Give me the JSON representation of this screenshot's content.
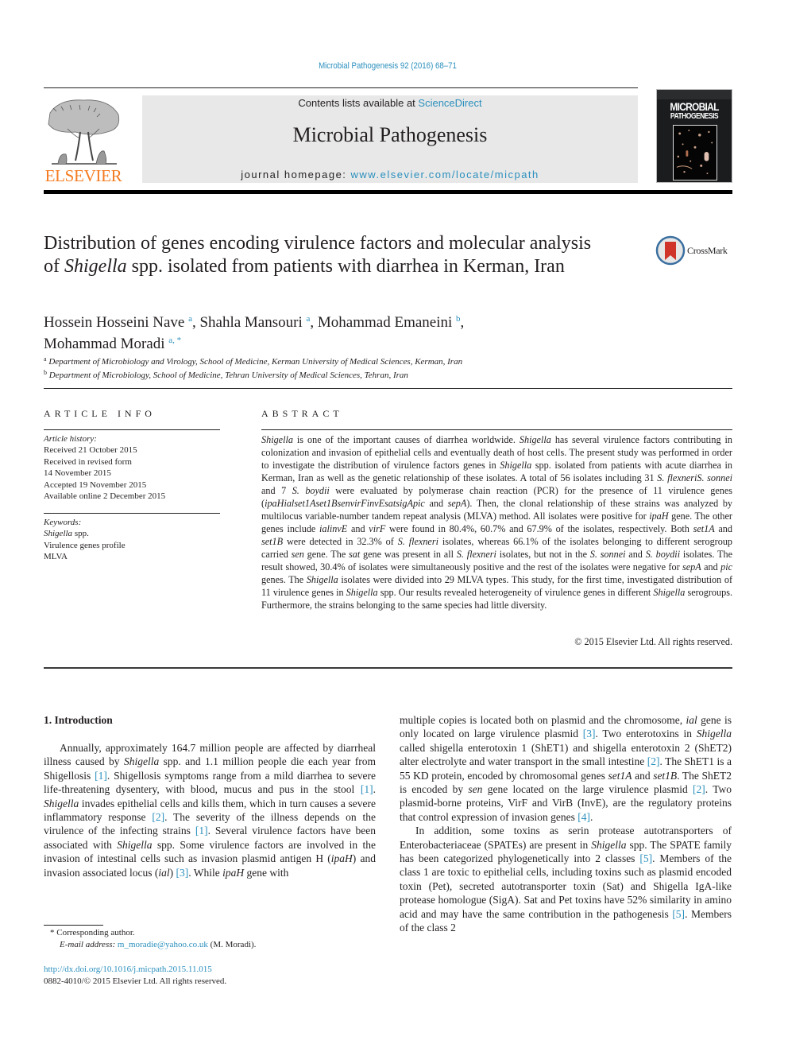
{
  "header": {
    "journal_ref": "Microbial Pathogenesis 92 (2016) 68–71",
    "contents_prefix": "Contents lists available at ",
    "contents_link": "ScienceDirect",
    "journal_title": "Microbial Pathogenesis",
    "homepage_prefix": "journal homepage: ",
    "homepage_link": "www.elsevier.com/locate/micpath",
    "publisher_logo_text": "ELSEVIER",
    "cover_title_line1": "MICROBIAL",
    "cover_title_line2": "PATHOGENESIS",
    "crossmark_label": "CrossMark",
    "colors": {
      "link": "#2a8fbd",
      "elsevier_orange": "#f47b20",
      "grey_box": "#e8e8e8"
    }
  },
  "article": {
    "title_part1": "Distribution of genes encoding virulence factors and molecular analysis of ",
    "title_italic": "Shigella",
    "title_part2": " spp. isolated from patients with diarrhea in Kerman, Iran",
    "authors": [
      {
        "name": "Hossein Hosseini Nave",
        "sup": "a",
        "sep": ", "
      },
      {
        "name": "Shahla Mansouri",
        "sup": "a",
        "sep": ", "
      },
      {
        "name": "Mohammad Emaneini",
        "sup": "b",
        "sep": ","
      },
      {
        "name": "Mohammad Moradi",
        "sup": "a, *",
        "sep": ""
      }
    ],
    "affiliations": [
      {
        "sup": "a",
        "text": "Department of Microbiology and Virology, School of Medicine, Kerman University of Medical Sciences, Kerman, Iran"
      },
      {
        "sup": "b",
        "text": "Department of Microbiology, School of Medicine, Tehran University of Medical Sciences, Tehran, Iran"
      }
    ]
  },
  "article_info": {
    "heading": "ARTICLE INFO",
    "history_label": "Article history:",
    "history": [
      "Received 21 October 2015",
      "Received in revised form",
      "14 November 2015",
      "Accepted 19 November 2015",
      "Available online 2 December 2015"
    ],
    "keywords_label": "Keywords:",
    "keyword1_italic": "Shigella",
    "keyword1_rest": " spp.",
    "keywords": [
      "Virulence genes profile",
      "MLVA"
    ]
  },
  "abstract": {
    "heading": "ABSTRACT",
    "copyright": "© 2015 Elsevier Ltd. All rights reserved."
  },
  "intro": {
    "heading": "1.  Introduction"
  },
  "footnotes": {
    "corresponding": "* Corresponding author.",
    "email_label": "E-mail address: ",
    "email": "m_moradie@yahoo.co.uk",
    "email_suffix": " (M. Moradi).",
    "doi": "http://dx.doi.org/10.1016/j.micpath.2015.11.015",
    "issn_line": "0882-4010/© 2015 Elsevier Ltd. All rights reserved."
  }
}
